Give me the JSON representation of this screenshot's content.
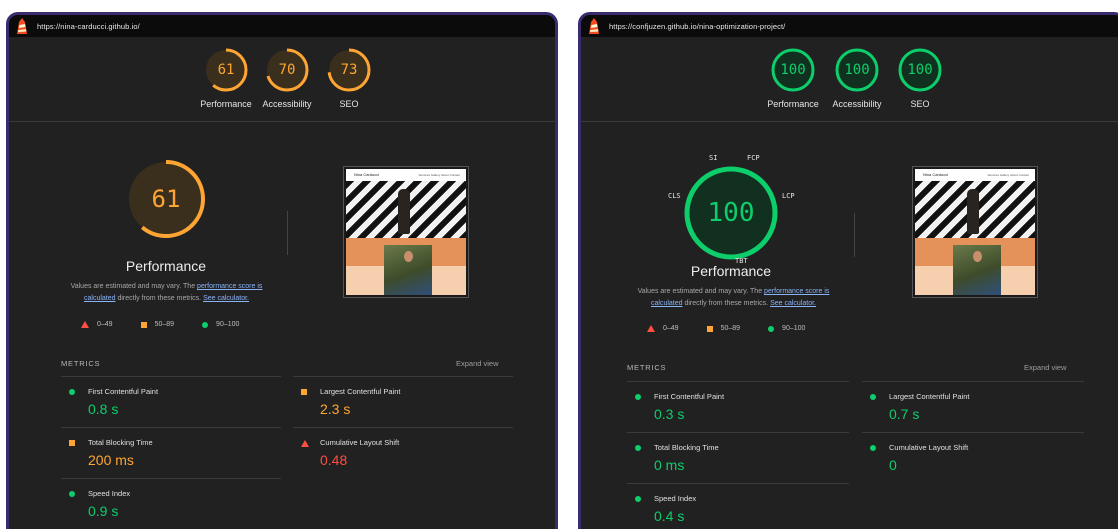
{
  "colors": {
    "orange": "#ffa534",
    "green": "#0cce6b",
    "red": "#ff4e42",
    "panel_bg": "#212121",
    "link": "#8ab4f8"
  },
  "left": {
    "url": "https://nina-carducci.github.io/",
    "scores": [
      {
        "value": "61",
        "label": "Performance",
        "percent": 61,
        "status": "orange"
      },
      {
        "value": "70",
        "label": "Accessibility",
        "percent": 70,
        "status": "orange"
      },
      {
        "value": "73",
        "label": "SEO",
        "percent": 73,
        "status": "orange"
      }
    ],
    "main_score": "61",
    "main_percent": 61,
    "perf_title": "Performance",
    "desc_prefix": "Values are estimated and may vary. The",
    "desc_link1": "performance score is calculated",
    "desc_middle": "directly from these metrics.",
    "desc_link2": "See calculator.",
    "legend": [
      "0–49",
      "50–89",
      "90–100"
    ],
    "metrics_header": "METRICS",
    "expand_label": "Expand view",
    "metrics": [
      {
        "label": "First Contentful Paint",
        "value": "0.8 s",
        "status": "green"
      },
      {
        "label": "Largest Contentful Paint",
        "value": "2.3 s",
        "status": "orange"
      },
      {
        "label": "Total Blocking Time",
        "value": "200 ms",
        "status": "orange"
      },
      {
        "label": "Cumulative Layout Shift",
        "value": "0.48",
        "status": "red"
      },
      {
        "label": "Speed Index",
        "value": "0.9 s",
        "status": "green"
      }
    ],
    "thumb": {
      "brand": "Nina Carducci",
      "nav": "Services  Gallery  About  Contact"
    }
  },
  "right": {
    "url": "https://confjuzen.github.io/nina-optimization-project/",
    "scores": [
      {
        "value": "100",
        "label": "Performance",
        "percent": 100,
        "status": "green"
      },
      {
        "value": "100",
        "label": "Accessibility",
        "percent": 100,
        "status": "green"
      },
      {
        "value": "100",
        "label": "SEO",
        "percent": 100,
        "status": "green"
      }
    ],
    "main_score": "100",
    "main_percent": 100,
    "gauge_labels": {
      "si": "SI",
      "fcp": "FCP",
      "cls": "CLS",
      "lcp": "LCP",
      "tbt": "TBT"
    },
    "perf_title": "Performance",
    "desc_prefix": "Values are estimated and may vary. The",
    "desc_link1": "performance score is calculated",
    "desc_middle": "directly from these metrics.",
    "desc_link2": "See calculator.",
    "legend": [
      "0–49",
      "50–89",
      "90–100"
    ],
    "metrics_header": "METRICS",
    "expand_label": "Expand view",
    "metrics": [
      {
        "label": "First Contentful Paint",
        "value": "0.3 s",
        "status": "green"
      },
      {
        "label": "Largest Contentful Paint",
        "value": "0.7 s",
        "status": "green"
      },
      {
        "label": "Total Blocking Time",
        "value": "0 ms",
        "status": "green"
      },
      {
        "label": "Cumulative Layout Shift",
        "value": "0",
        "status": "green"
      },
      {
        "label": "Speed Index",
        "value": "0.4 s",
        "status": "green"
      }
    ],
    "thumb": {
      "brand": "Nina Carducci",
      "nav": "Services  Gallery  About  Contact"
    }
  }
}
